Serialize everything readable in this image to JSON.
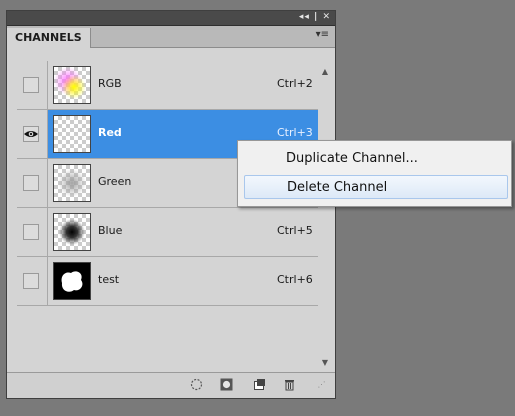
{
  "panel": {
    "title_buttons": "◂◂ | ✕",
    "tab_label": "CHANNELS",
    "panel_menu_icon": "▾≡",
    "channels": [
      {
        "name": "RGB",
        "shortcut": "Ctrl+2",
        "visible": false,
        "selected": false,
        "thumb": "rgb-blend"
      },
      {
        "name": "Red",
        "shortcut": "Ctrl+3",
        "visible": true,
        "selected": true,
        "thumb": "transparent"
      },
      {
        "name": "Green",
        "shortcut": "",
        "visible": false,
        "selected": false,
        "thumb": "gray-blob"
      },
      {
        "name": "Blue",
        "shortcut": "Ctrl+5",
        "visible": false,
        "selected": false,
        "thumb": "dark-dot"
      },
      {
        "name": "test",
        "shortcut": "Ctrl+6",
        "visible": false,
        "selected": false,
        "thumb": "white-blob"
      }
    ],
    "eye_glyph": "👁",
    "scroll_up": "▲",
    "scroll_down": "▼",
    "bottom_icons": [
      "selection-icon",
      "mask-icon",
      "new-channel-icon",
      "trash-icon"
    ]
  },
  "context_menu": {
    "items": [
      {
        "label": "Duplicate Channel...",
        "hover": false
      },
      {
        "label": "Delete Channel",
        "hover": true
      }
    ]
  },
  "colors": {
    "selected_row": "#3c8ee3",
    "panel_bg": "#d4d4d4",
    "desktop_bg": "#7a7a7a"
  }
}
